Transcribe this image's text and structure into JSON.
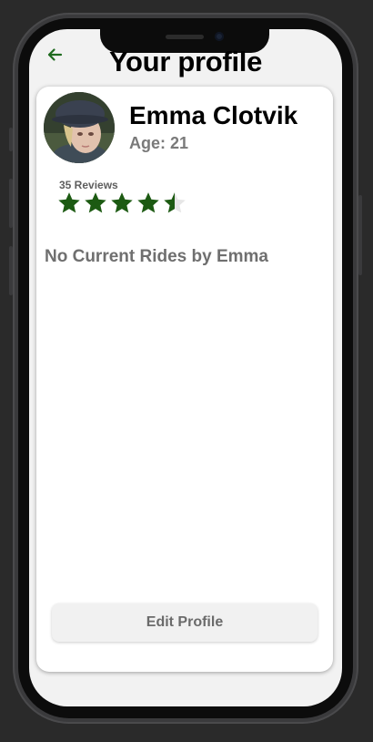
{
  "header": {
    "title": "Your profile",
    "back_icon": "arrow-left-icon",
    "back_icon_color": "#1f6b1f"
  },
  "profile": {
    "name": "Emma Clotvik",
    "age_text": "Age: 21",
    "avatar": "avatar-photo"
  },
  "rating": {
    "reviews_text": "35 Reviews",
    "stars_value": 4.5,
    "stars_max": 5,
    "star_color": "#1c5a12",
    "empty_star_color": "#e6e6e6"
  },
  "rides": {
    "empty_text": "No Current Rides by Emma"
  },
  "actions": {
    "edit_label": "Edit Profile"
  }
}
